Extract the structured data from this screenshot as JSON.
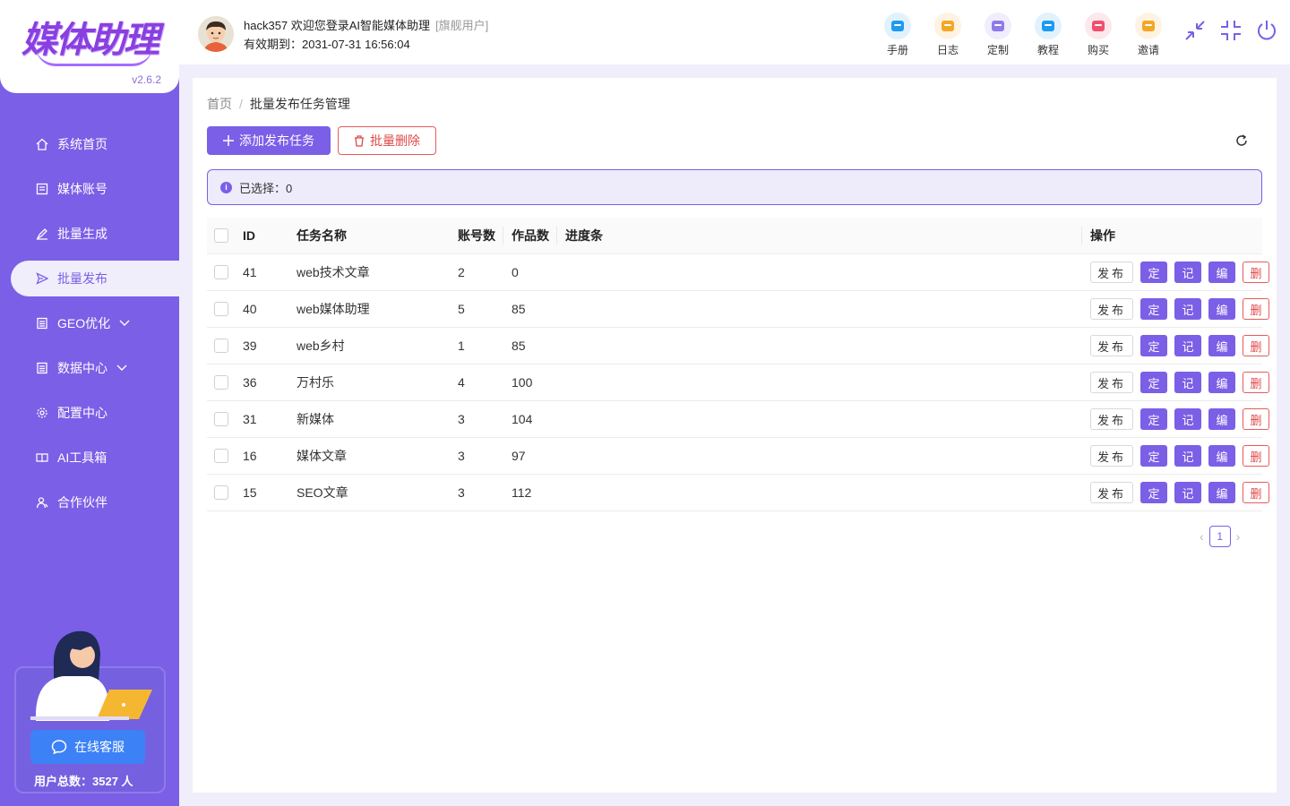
{
  "brand": {
    "logo_text": "媒体助理",
    "version": "v2.6.2"
  },
  "sidebar": {
    "items": [
      {
        "label": "系统首页",
        "icon": "home-icon"
      },
      {
        "label": "媒体账号",
        "icon": "account-icon"
      },
      {
        "label": "批量生成",
        "icon": "edit-icon"
      },
      {
        "label": "批量发布",
        "icon": "send-icon",
        "active": true
      },
      {
        "label": "GEO优化",
        "icon": "doc-icon",
        "expandable": true
      },
      {
        "label": "数据中心",
        "icon": "data-icon",
        "expandable": true
      },
      {
        "label": "配置中心",
        "icon": "gear-icon"
      },
      {
        "label": "AI工具箱",
        "icon": "book-icon"
      },
      {
        "label": "合作伙伴",
        "icon": "partner-icon"
      }
    ],
    "service_button": "在线客服",
    "user_count": "用户总数：3527 人"
  },
  "header": {
    "welcome": "hack357 欢迎您登录AI智能媒体助理",
    "user_tag": "[旗舰用户]",
    "expire": "有效期到：2031-07-31 16:56:04",
    "tools": [
      {
        "label": "手册",
        "color": "#1e9bf0"
      },
      {
        "label": "日志",
        "color": "#f5a623"
      },
      {
        "label": "定制",
        "color": "#8f7aea"
      },
      {
        "label": "教程",
        "color": "#1e9bf0"
      },
      {
        "label": "购买",
        "color": "#f0506e"
      },
      {
        "label": "邀请",
        "color": "#f5a623"
      }
    ]
  },
  "breadcrumb": {
    "home": "首页",
    "sep": "/",
    "current": "批量发布任务管理"
  },
  "toolbar": {
    "add_label": "添加发布任务",
    "delete_label": "批量删除"
  },
  "alert": {
    "selected": "已选择：0"
  },
  "table": {
    "headers": {
      "id": "ID",
      "name": "任务名称",
      "accounts": "账号数",
      "works": "作品数",
      "progress": "进度条",
      "ops": "操作"
    },
    "op_labels": {
      "publish": "发布",
      "schedule": "定",
      "record": "记",
      "edit": "编",
      "delete": "删"
    },
    "rows": [
      {
        "id": "41",
        "name": "web技术文章",
        "accounts": "2",
        "works": "0"
      },
      {
        "id": "40",
        "name": "web媒体助理",
        "accounts": "5",
        "works": "85"
      },
      {
        "id": "39",
        "name": "web乡村",
        "accounts": "1",
        "works": "85"
      },
      {
        "id": "36",
        "name": "万村乐",
        "accounts": "4",
        "works": "100"
      },
      {
        "id": "31",
        "name": "新媒体",
        "accounts": "3",
        "works": "104"
      },
      {
        "id": "16",
        "name": "媒体文章",
        "accounts": "3",
        "works": "97"
      },
      {
        "id": "15",
        "name": "SEO文章",
        "accounts": "3",
        "works": "112"
      }
    ]
  },
  "pagination": {
    "current": "1",
    "prev": "‹",
    "next": "›"
  }
}
